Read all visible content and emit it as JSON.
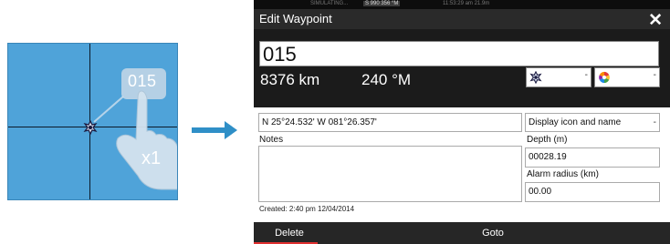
{
  "illustration": {
    "waypoint_label": "015",
    "tap_count": "x1"
  },
  "status_bar": {
    "left_text": "SIMULATING...",
    "highlight_text": "S 990 356 °M",
    "time_text": "11:53:29 am  21.9m"
  },
  "dialog": {
    "title": "Edit Waypoint",
    "close_symbol": "✕",
    "name_value": "015",
    "distance": "8376 km",
    "bearing": "240 °M",
    "icon_select": {
      "icon": "waypoint-icon",
      "dropdown": "-"
    },
    "color_select": {
      "icon": "color-wheel-icon",
      "dropdown": "-"
    },
    "position": "N 25°24.532'  W 081°26.357'",
    "display_option": "Display icon and name",
    "notes_label": "Notes",
    "notes_value": "",
    "depth_label": "Depth (m)",
    "depth_value": "00028.19",
    "alarm_label": "Alarm radius (km)",
    "alarm_value": "00.00",
    "created": "Created: 2:40 pm  12/04/2014"
  },
  "buttons": {
    "delete": "Delete",
    "goto": "Goto"
  },
  "colors": {
    "chart_water": "#4fa3d9",
    "dialog_bg": "#1b1b1b",
    "delete_underline": "#e03030",
    "arrow": "#2f8fc7"
  }
}
